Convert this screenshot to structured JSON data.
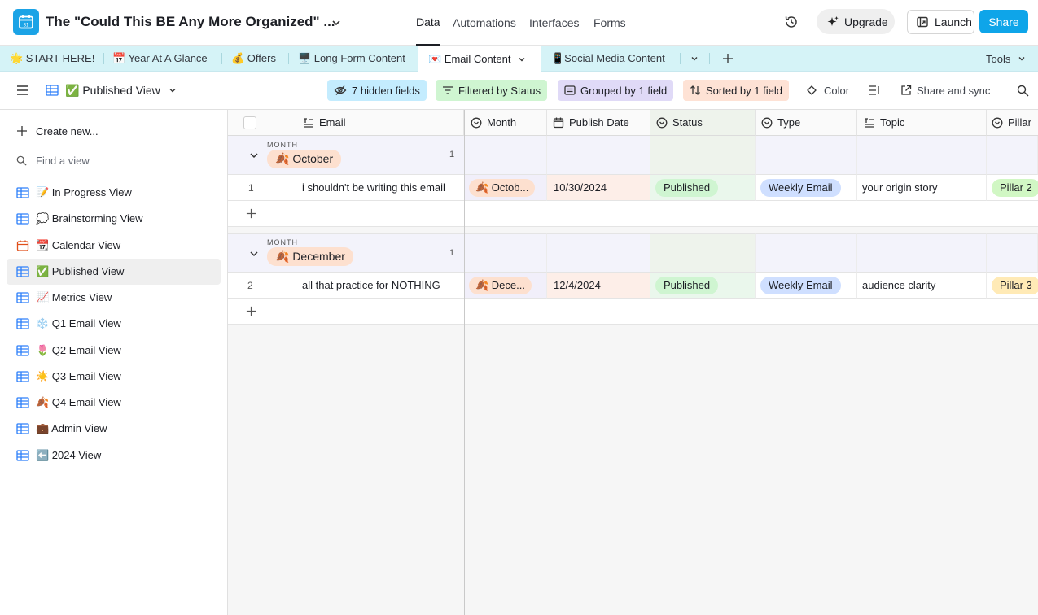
{
  "topbar": {
    "title": "The \"Could This BE Any More Organized\" ...",
    "nav": [
      "Data",
      "Automations",
      "Interfaces",
      "Forms"
    ],
    "upgrade_label": "Upgrade",
    "launch_label": "Launch",
    "share_label": "Share",
    "brand_color": "#1ba3e6"
  },
  "tabs": {
    "items": [
      "🌟 START HERE!",
      "📅 Year At A Glance",
      "💰 Offers",
      "🖥️ Long Form Content",
      "💌 Email Content",
      "📱Social Media Content"
    ],
    "tools_label": "Tools"
  },
  "viewbar": {
    "view_name": "✅ Published View",
    "hidden_fields": "7 hidden fields",
    "filtered": "Filtered by Status",
    "grouped": "Grouped by 1 field",
    "sorted": "Sorted by 1 field",
    "color": "Color",
    "share_sync": "Share and sync"
  },
  "sidebar": {
    "create_new": "Create new...",
    "find_placeholder": "Find a view",
    "views": [
      "📝 In Progress View",
      "💭 Brainstorming View",
      "📆 Calendar View",
      "✅ Published View",
      "📈 Metrics View",
      "❄️ Q1 Email View",
      "🌷 Q2 Email View",
      "☀️ Q3 Email View",
      "🍂 Q4 Email View",
      "💼 Admin View",
      "⬅️ 2024 View"
    ]
  },
  "grid": {
    "columns": [
      "Email",
      "Month",
      "Publish Date",
      "Status",
      "Type",
      "Topic",
      "Pillar"
    ],
    "group_field_label": "MONTH",
    "groups": [
      {
        "name": "🍂 October",
        "count": "1",
        "rows": [
          {
            "num": "1",
            "email": "i shouldn't be writing this email",
            "month": "🍂 Octob...",
            "date": "10/30/2024",
            "status": "Published",
            "type": "Weekly Email",
            "topic": "your origin story",
            "pillar": "Pillar 2"
          }
        ]
      },
      {
        "name": "🍂 December",
        "count": "1",
        "rows": [
          {
            "num": "2",
            "email": "all that practice for NOTHING",
            "month": "🍂 Dece...",
            "date": "12/4/2024",
            "status": "Published",
            "type": "Weekly Email",
            "topic": "audience clarity",
            "pillar": "Pillar 3"
          }
        ]
      }
    ]
  }
}
